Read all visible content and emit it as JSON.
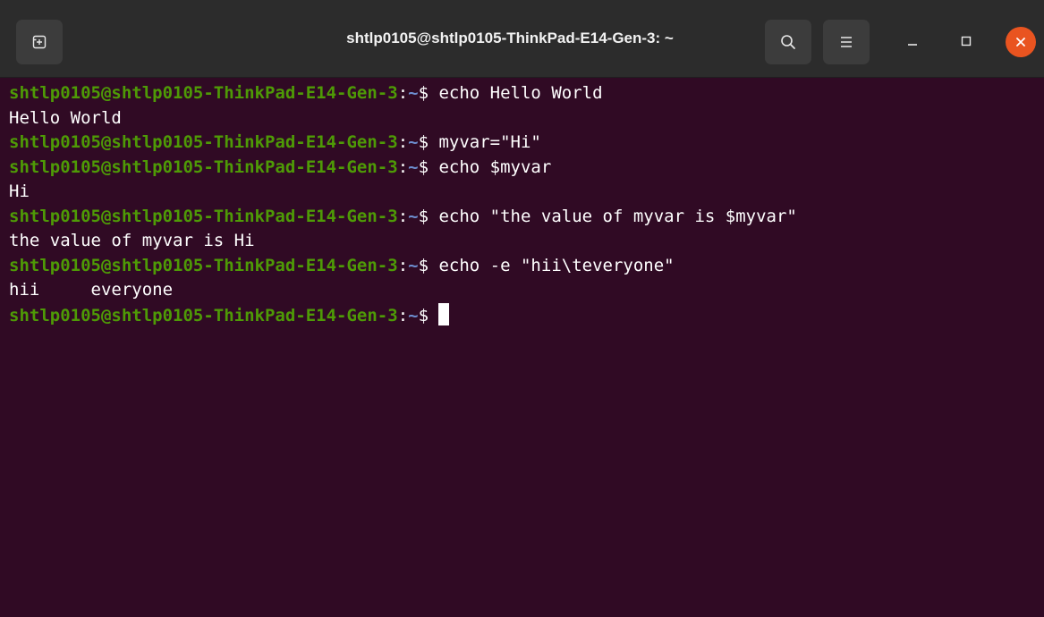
{
  "window": {
    "title": "shtlp0105@shtlp0105-ThinkPad-E14-Gen-3: ~"
  },
  "toolbar": {
    "new_tab_icon": "new-tab-icon",
    "search_icon": "search-icon",
    "menu_icon": "hamburger-menu-icon",
    "minimize_icon": "minimize-icon",
    "maximize_icon": "maximize-icon",
    "close_icon": "close-icon"
  },
  "colors": {
    "terminal_bg": "#300a24",
    "prompt_user": "#4e9a06",
    "prompt_path": "#6e8fd1",
    "close_button": "#e95420"
  },
  "terminal": {
    "lines": [
      {
        "user": "shtlp0105@shtlp0105-ThinkPad-E14-Gen-3",
        "sep": ":",
        "path": "~",
        "prompt": "$ ",
        "cmd": "echo Hello World"
      },
      {
        "output": "Hello World"
      },
      {
        "user": "shtlp0105@shtlp0105-ThinkPad-E14-Gen-3",
        "sep": ":",
        "path": "~",
        "prompt": "$ ",
        "cmd": "myvar=\"Hi\""
      },
      {
        "user": "shtlp0105@shtlp0105-ThinkPad-E14-Gen-3",
        "sep": ":",
        "path": "~",
        "prompt": "$ ",
        "cmd": "echo $myvar"
      },
      {
        "output": "Hi"
      },
      {
        "user": "shtlp0105@shtlp0105-ThinkPad-E14-Gen-3",
        "sep": ":",
        "path": "~",
        "prompt": "$ ",
        "cmd": "echo \"the value of myvar is $myvar\""
      },
      {
        "output": "the value of myvar is Hi"
      },
      {
        "user": "shtlp0105@shtlp0105-ThinkPad-E14-Gen-3",
        "sep": ":",
        "path": "~",
        "prompt": "$ ",
        "cmd": "echo -e \"hii\\teveryone\""
      },
      {
        "output": "hii     everyone"
      },
      {
        "user": "shtlp0105@shtlp0105-ThinkPad-E14-Gen-3",
        "sep": ":",
        "path": "~",
        "prompt": "$ ",
        "cmd": ""
      }
    ]
  }
}
